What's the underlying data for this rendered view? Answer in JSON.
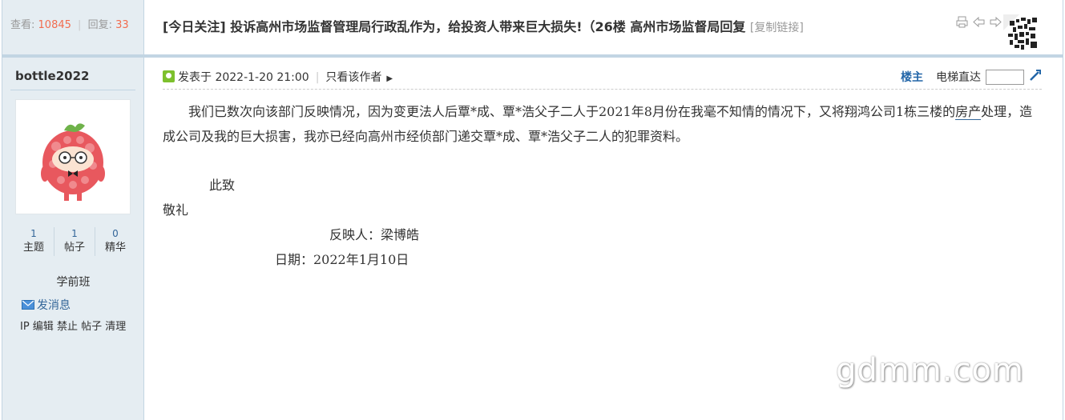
{
  "stats": {
    "views_label": "查看:",
    "views": "10845",
    "replies_label": "回复:",
    "replies": "33"
  },
  "thread": {
    "title": "[今日关注] 投诉高州市场监督管理局行政乱作为，给投资人带来巨大损失!（26楼 高州市场监督局回复",
    "copy_link": "[复制链接]"
  },
  "author": {
    "username": "bottle2022",
    "stats": [
      {
        "value": "1",
        "label": "主题"
      },
      {
        "value": "1",
        "label": "帖子"
      },
      {
        "value": "0",
        "label": "精华"
      }
    ],
    "group": "学前班",
    "send_message": "发消息",
    "admin_links": "IP 编辑 禁止 帖子 清理"
  },
  "post": {
    "posted_at": "发表于 2022-1-20 21:00",
    "only_author": "只看该作者",
    "floor": "楼主",
    "jump_label": "电梯直达",
    "body_para_1": "我们已数次向该部门反映情况，因为变更法人后覃*成、覃*浩父子二人于2021年8月份在我毫不知情的情况下，又将翔鸿公司1栋三楼的",
    "body_link": "房产",
    "body_para_2": "处理，造成公司及我的巨大损害，我亦已经向高州市经侦部门递交覃*成、覃*浩父子二人的犯罪资料。",
    "salutation_1": "此致",
    "salutation_2": "敬礼",
    "signer": "反映人：梁博皓",
    "date": "日期：2022年1月10日"
  },
  "watermark": "gdmm.com",
  "colors": {
    "accent_red": "#f26c4f",
    "link_blue": "#2366a8",
    "sidebar_bg": "#e5edf2",
    "border": "#c2d5e3"
  },
  "icons": [
    "print-icon",
    "prev-thread-icon",
    "next-thread-icon",
    "qr-code-icon",
    "online-status-icon",
    "mail-icon",
    "go-icon"
  ]
}
